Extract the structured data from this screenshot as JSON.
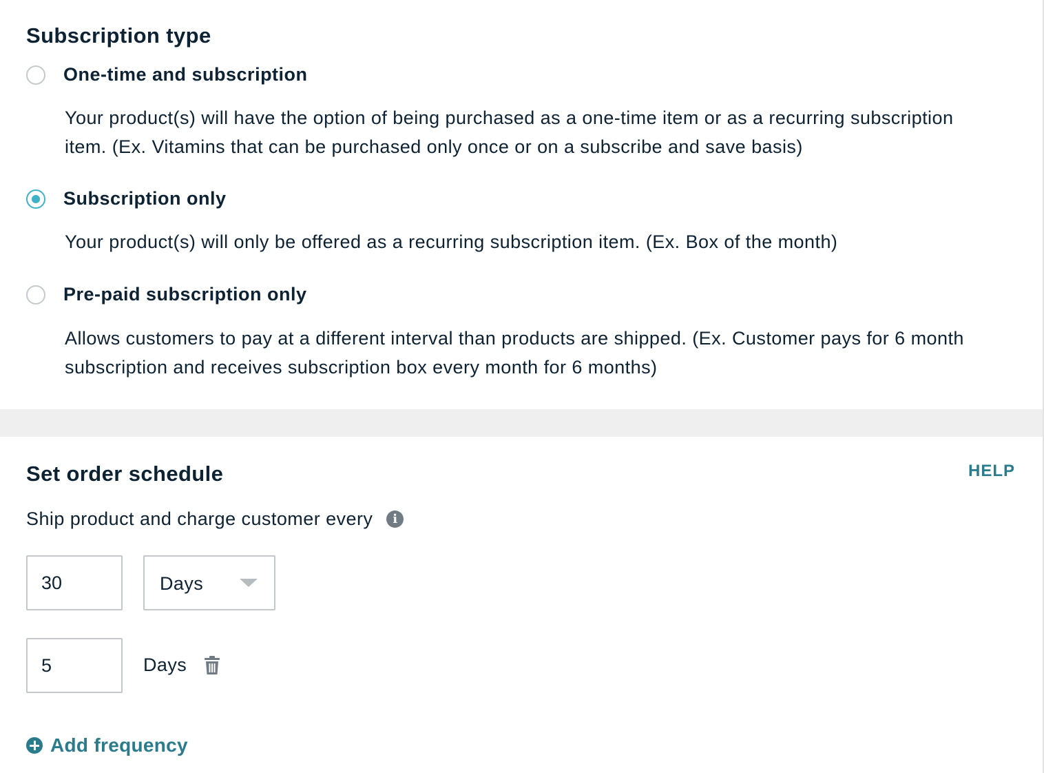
{
  "subscription_type": {
    "title": "Subscription type",
    "options": [
      {
        "label": "One-time and subscription",
        "description": "Your product(s) will have the option of being purchased as a one-time item or as a recurring subscription item. (Ex. Vitamins that can be purchased only once or on a subscribe and save basis)",
        "selected": false
      },
      {
        "label": "Subscription only",
        "description": "Your product(s) will only be offered as a recurring subscription item. (Ex. Box of the month)",
        "selected": true
      },
      {
        "label": "Pre-paid subscription only",
        "description": "Allows customers to pay at a different interval than products are shipped. (Ex. Customer pays for 6 month subscription and receives subscription box every month for 6 months)",
        "selected": false
      }
    ]
  },
  "order_schedule": {
    "title": "Set order schedule",
    "help_label": "HELP",
    "ship_label": "Ship product and charge customer every",
    "info_icon": "info-icon",
    "frequency_1": {
      "value": "30",
      "unit": "Days"
    },
    "frequency_2": {
      "value": "5",
      "unit": "Days",
      "delete_icon": "trash-icon"
    },
    "add_frequency_label": "Add frequency",
    "add_icon": "plus-circle-icon"
  },
  "colors": {
    "accent": "#2a7c8c",
    "radio_selected": "#3fb1c9",
    "text": "#0d2233",
    "divider": "#efefef"
  }
}
